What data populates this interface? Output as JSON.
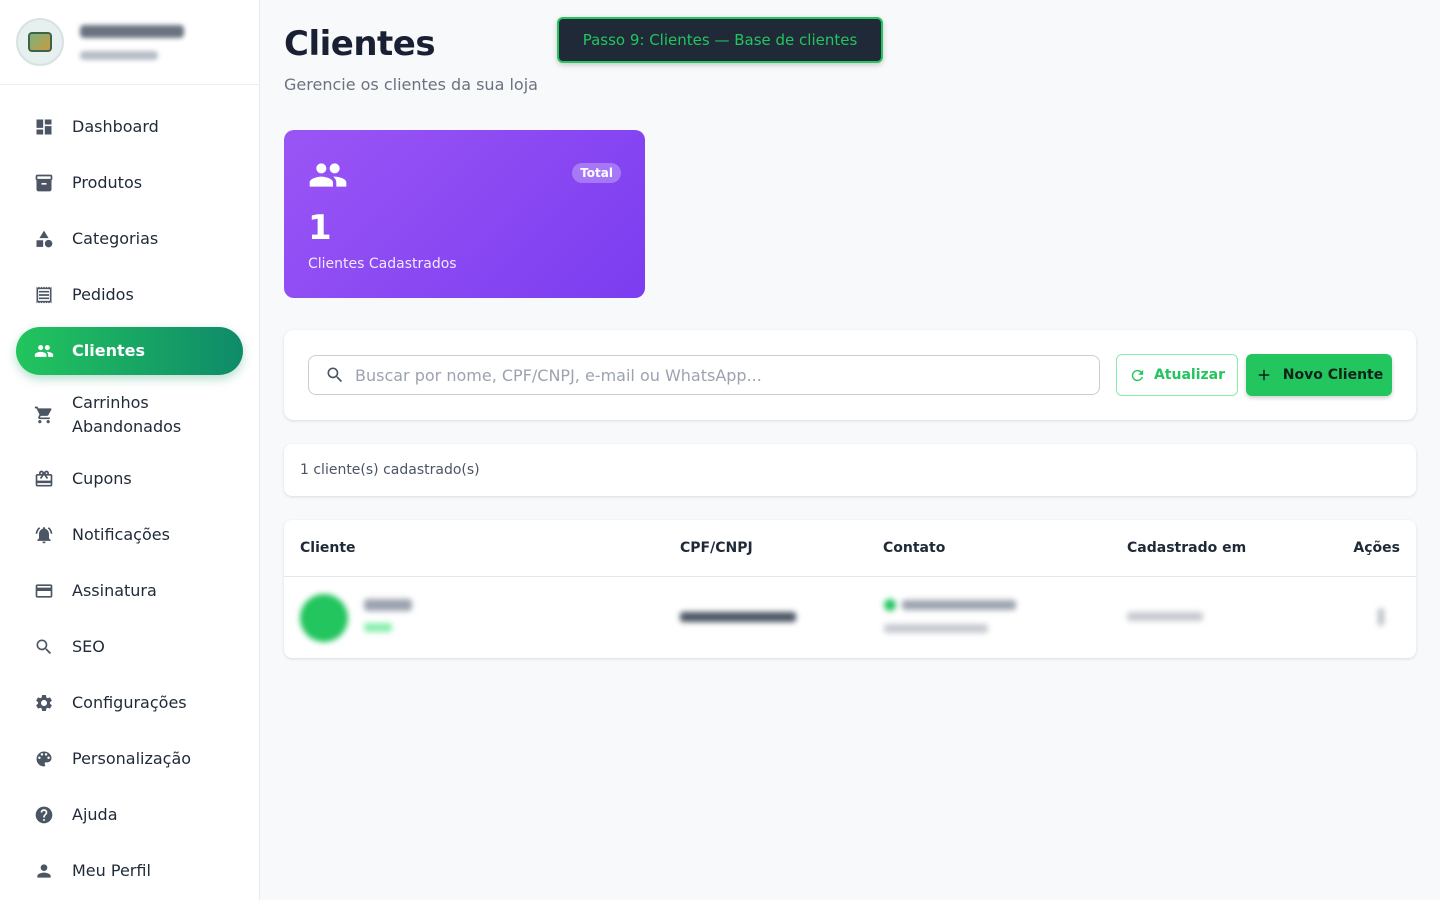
{
  "sidebar": {
    "items": [
      {
        "label": "Dashboard",
        "icon": "dashboard-icon"
      },
      {
        "label": "Produtos",
        "icon": "archive-icon"
      },
      {
        "label": "Categorias",
        "icon": "shapes-icon"
      },
      {
        "label": "Pedidos",
        "icon": "receipt-icon"
      },
      {
        "label": "Clientes",
        "icon": "people-icon",
        "active": true
      },
      {
        "label": "Carrinhos Abandonados",
        "icon": "cart-icon"
      },
      {
        "label": "Cupons",
        "icon": "coupon-icon"
      },
      {
        "label": "Notificações",
        "icon": "bell-icon"
      },
      {
        "label": "Assinatura",
        "icon": "credit-card-icon"
      },
      {
        "label": "SEO",
        "icon": "search-icon"
      },
      {
        "label": "Configurações",
        "icon": "gear-icon"
      },
      {
        "label": "Personalização",
        "icon": "palette-icon"
      },
      {
        "label": "Ajuda",
        "icon": "help-icon"
      },
      {
        "label": "Meu Perfil",
        "icon": "person-icon"
      }
    ]
  },
  "header": {
    "title": "Clientes",
    "subtitle": "Gerencie os clientes da sua loja",
    "tour_step": "Passo 9: Clientes — Base de clientes"
  },
  "stats": {
    "badge": "Total",
    "value": "1",
    "label": "Clientes Cadastrados"
  },
  "search": {
    "placeholder": "Buscar por nome, CPF/CNPJ, e-mail ou WhatsApp...",
    "value": ""
  },
  "actions": {
    "refresh_label": "Atualizar",
    "new_label": "Novo Cliente"
  },
  "count_text": "1 cliente(s) cadastrado(s)",
  "table": {
    "columns": [
      "Cliente",
      "CPF/CNPJ",
      "Contato",
      "Cadastrado em",
      "Ações"
    ]
  },
  "colors": {
    "accent": "#22c55e",
    "accent_dark": "#0f8a6a",
    "stat_card": "#8b4af3"
  }
}
